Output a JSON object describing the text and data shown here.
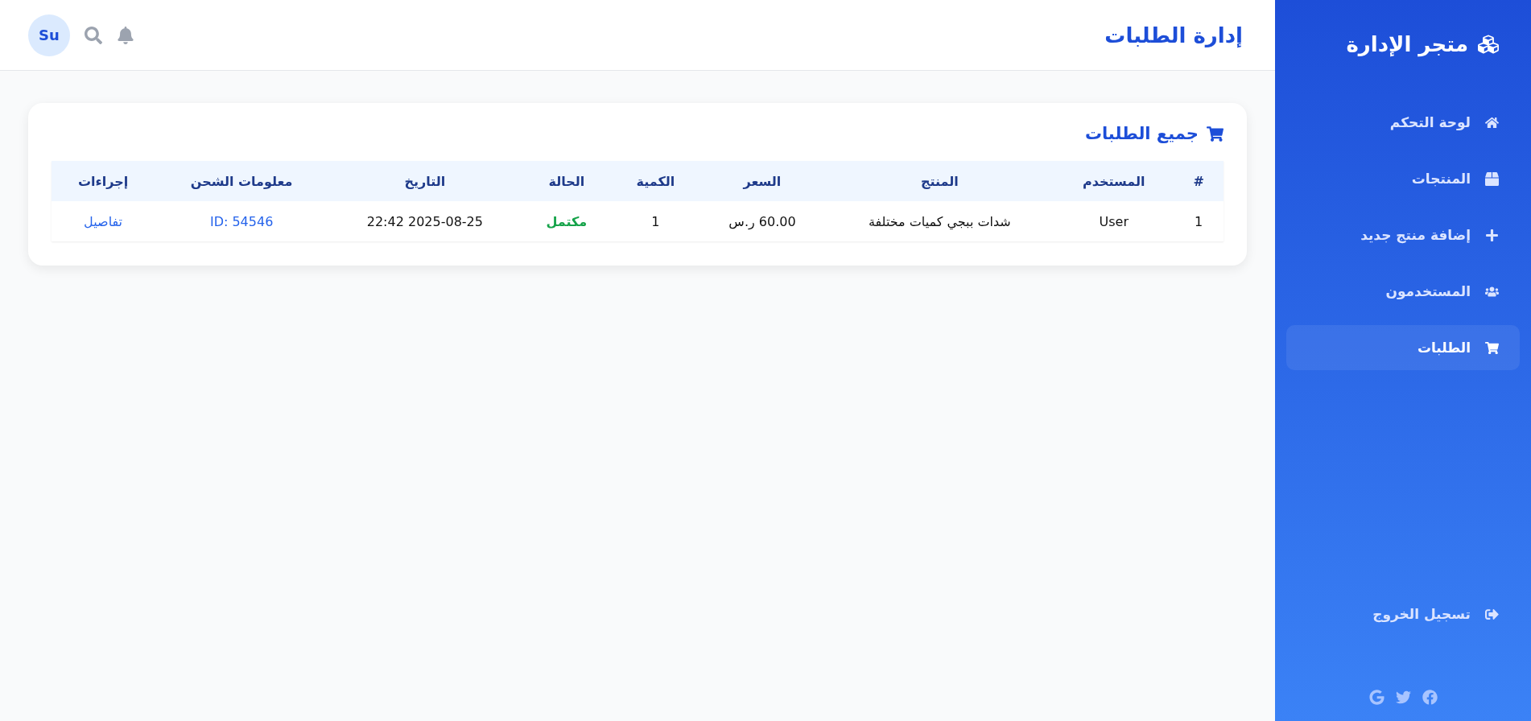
{
  "sidebar": {
    "brand": "متجر الإدارة",
    "items": [
      {
        "kind": "dashboard",
        "label": "لوحة التحكم",
        "selected": false
      },
      {
        "kind": "products",
        "label": "المنتجات",
        "selected": false
      },
      {
        "kind": "add",
        "label": "إضافة منتج جديد",
        "selected": false
      },
      {
        "kind": "users",
        "label": "المستخدمون",
        "selected": false
      },
      {
        "kind": "orders",
        "label": "الطلبات",
        "selected": true
      }
    ],
    "logout": "تسجيل الخروج"
  },
  "header": {
    "title": "إدارة الطلبات",
    "avatar": "Su"
  },
  "card": {
    "title": "جميع الطلبات",
    "table": {
      "columns": [
        {
          "label": "#",
          "kind": "text"
        },
        {
          "label": "المستخدم",
          "kind": "text"
        },
        {
          "label": "المنتج",
          "kind": "text"
        },
        {
          "label": "السعر",
          "kind": "text"
        },
        {
          "label": "الكمية",
          "kind": "text"
        },
        {
          "label": "الحالة",
          "kind": "status"
        },
        {
          "label": "التاريخ",
          "kind": "text"
        },
        {
          "label": "معلومات الشحن",
          "kind": "link"
        },
        {
          "label": "إجراءات",
          "kind": "link"
        }
      ],
      "rows": [
        {
          "cells": [
            "1",
            "User",
            "شدات ببجي كميات مختلفة",
            "60.00 ر.س",
            "1",
            "مكتمل",
            "2025-08-25 22:42",
            "ID: 54546",
            "تفاصيل"
          ]
        }
      ]
    }
  }
}
